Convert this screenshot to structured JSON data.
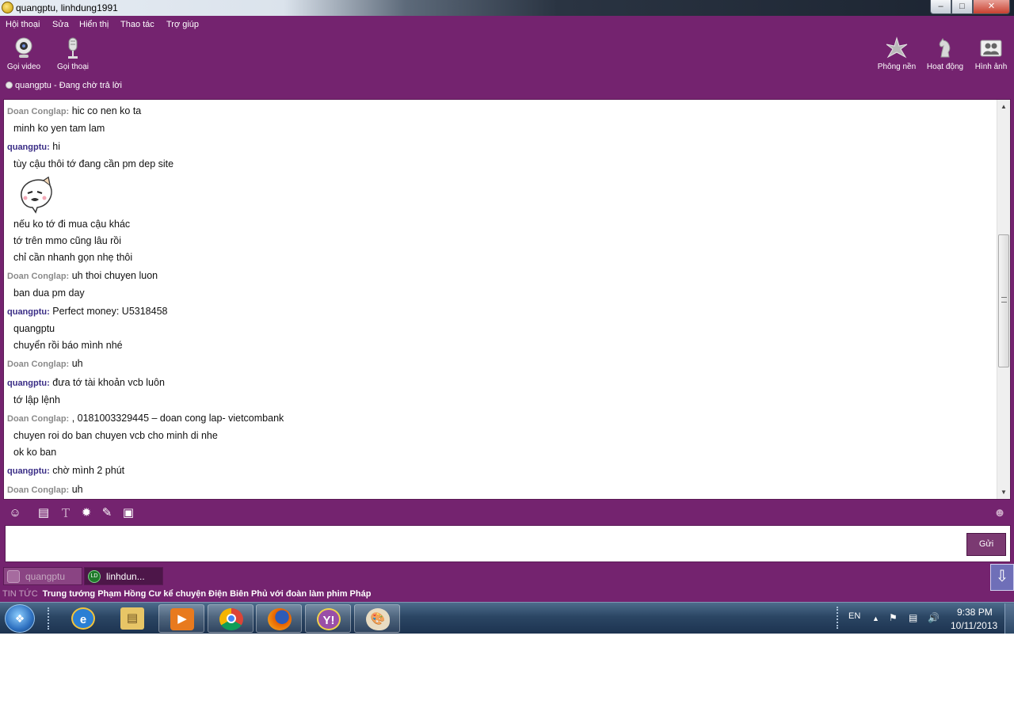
{
  "window": {
    "title": "quangptu, linhdung1991"
  },
  "menu": [
    "Hội thoại",
    "Sửa",
    "Hiển thị",
    "Thao tác",
    "Trợ giúp"
  ],
  "toolbar": {
    "left": [
      {
        "label": "Gọi video",
        "icon": "webcam-icon"
      },
      {
        "label": "Gọi thoại",
        "icon": "microphone-icon"
      }
    ],
    "right": [
      {
        "label": "Phông nền",
        "icon": "flower-icon"
      },
      {
        "label": "Hoạt động",
        "icon": "chess-knight-icon"
      },
      {
        "label": "Hình ảnh",
        "icon": "photo-people-icon"
      }
    ]
  },
  "status": {
    "contact": "quangptu",
    "separator": "-",
    "text": "Đang chờ trả lời"
  },
  "conversation": {
    "messages": [
      {
        "sender": "Doan Conglap:",
        "text": "hic co nen ko ta"
      },
      {
        "text": "minh ko yen tam lam"
      },
      {
        "sender": "quangptu:",
        "text": "hi"
      },
      {
        "text": "tùy cậu thôi tớ đang cần pm dep site"
      },
      {
        "text": "nếu ko tớ đi mua cậu khác"
      },
      {
        "text": "tớ trên mmo cũng lâu rồi"
      },
      {
        "text": "chỉ cần nhanh gọn nhẹ thôi"
      },
      {
        "sender": "Doan Conglap:",
        "text": "uh thoi chuyen luon"
      },
      {
        "text": "ban dua pm day"
      },
      {
        "sender": "quangptu:",
        "text": "Perfect money: U5318458"
      },
      {
        "text": "quangptu"
      },
      {
        "text": "chuyển rồi báo mình nhé"
      },
      {
        "sender": "Doan Conglap:",
        "text": "uh"
      },
      {
        "sender": "quangptu:",
        "text": "đưa tớ tài khoản vcb luôn"
      },
      {
        "text": "tớ lập lệnh"
      },
      {
        "sender": "Doan Conglap:",
        "text": ", 0181003329445 – doan cong lap- vietcombank"
      },
      {
        "text": "chuyen roi do ban chuyen vcb cho minh di nhe"
      },
      {
        "text": "ok ko ban"
      },
      {
        "sender": "quangptu:",
        "text": "chờ mình 2 phút"
      },
      {
        "sender": "Doan Conglap:",
        "text": "uh"
      }
    ],
    "emoticon": "cartoon-face-emoticon"
  },
  "format_toolbar": [
    "smiley-icon",
    "nudge-icon",
    "font-icon",
    "sticker-icon",
    "pencil-icon",
    "screenshot-icon"
  ],
  "input": {
    "value": "",
    "send_label": "Gửi"
  },
  "tabs": [
    {
      "label": "quangptu",
      "active": false
    },
    {
      "label": "linhdun...",
      "active": true
    }
  ],
  "news": {
    "tag": "TIN TỨC",
    "headline": "Trung tướng Phạm Hồng Cư kể chuyện Điện Biên Phủ với đoàn làm phim Pháp"
  },
  "taskbar": {
    "apps": [
      "internet-explorer-icon",
      "file-explorer-icon",
      "media-player-icon",
      "chrome-icon",
      "firefox-icon",
      "yahoo-messenger-icon",
      "paint-icon"
    ],
    "language": "EN",
    "time": "9:38 PM",
    "date": "10/11/2013"
  },
  "colors": {
    "window_bg": "#74236f",
    "doan_sender": "#8a8a8a",
    "quang_sender": "#3a2d86",
    "send_button": "#7b3a72"
  }
}
